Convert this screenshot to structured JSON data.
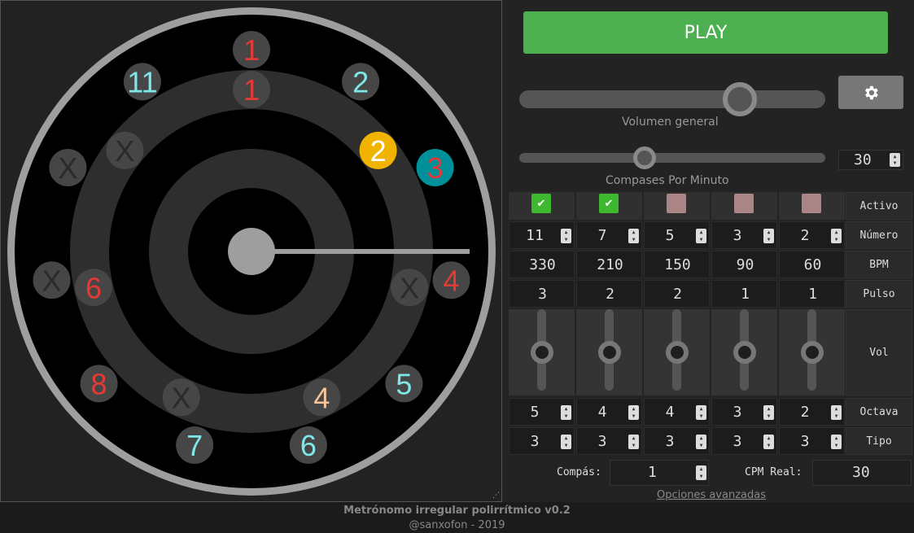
{
  "dial": {
    "outer_ring": [
      {
        "label": "1",
        "color": "#e53935"
      },
      {
        "label": "2",
        "color": "#7ee8e8"
      },
      {
        "label": "3",
        "color": "#e53935",
        "highlight": "#00909a"
      },
      {
        "label": "4",
        "color": "#e53935"
      },
      {
        "label": "5",
        "color": "#7ee8e8"
      },
      {
        "label": "6",
        "color": "#7ee8e8"
      },
      {
        "label": "7",
        "color": "#7ee8e8"
      },
      {
        "label": "8",
        "color": "#e53935"
      },
      {
        "label": "X",
        "color": "#2a2a2a"
      },
      {
        "label": "X",
        "color": "#2a2a2a"
      },
      {
        "label": "11",
        "color": "#7ee8e8"
      }
    ],
    "second_ring": [
      {
        "label": "1",
        "color": "#e53935"
      },
      {
        "label": "2",
        "color": "#ffffff",
        "highlight": "#f0b400"
      },
      {
        "label": "X",
        "color": "#2a2a2a"
      },
      {
        "label": "4",
        "color": "#f6c49a"
      },
      {
        "label": "X",
        "color": "#2a2a2a"
      },
      {
        "label": "6",
        "color": "#e53935"
      },
      {
        "label": "X",
        "color": "#2a2a2a"
      }
    ],
    "hand_angle_deg": 90
  },
  "controls": {
    "play_label": "PLAY",
    "gear_icon": "gear-icon",
    "volume_label": "Volumen general",
    "volume_level": 0.72,
    "cpm_label": "Compases Por Minuto",
    "cpm_level": 0.41,
    "cpm_value": "30"
  },
  "grid": {
    "row_labels": {
      "activo": "Activo",
      "numero": "Número",
      "bpm": "BPM",
      "pulso": "Pulso",
      "vol": "Vol",
      "octava": "Octava",
      "tipo": "Tipo"
    },
    "columns": [
      {
        "activo": true,
        "numero": "11",
        "bpm": "330",
        "pulso": "3",
        "vol": 0.5,
        "octava": "5",
        "tipo": "3"
      },
      {
        "activo": true,
        "numero": "7",
        "bpm": "210",
        "pulso": "2",
        "vol": 0.5,
        "octava": "4",
        "tipo": "3"
      },
      {
        "activo": false,
        "numero": "5",
        "bpm": "150",
        "pulso": "2",
        "vol": 0.5,
        "octava": "4",
        "tipo": "3"
      },
      {
        "activo": false,
        "numero": "3",
        "bpm": "90",
        "pulso": "1",
        "vol": 0.5,
        "octava": "3",
        "tipo": "3"
      },
      {
        "activo": false,
        "numero": "2",
        "bpm": "60",
        "pulso": "1",
        "vol": 0.5,
        "octava": "2",
        "tipo": "3"
      }
    ],
    "colors": {
      "checked": "#3db82f",
      "unchecked": "#a98585"
    }
  },
  "bottom": {
    "compas_label": "Compás:",
    "compas_value": "1",
    "cpm_real_label": "CPM Real:",
    "cpm_real_value": "30",
    "advanced_link": "Opciones avanzadas"
  },
  "footer": {
    "title": "Metrónomo irregular polirrítmico v0.2",
    "credit": "@sanxofon - 2019"
  }
}
